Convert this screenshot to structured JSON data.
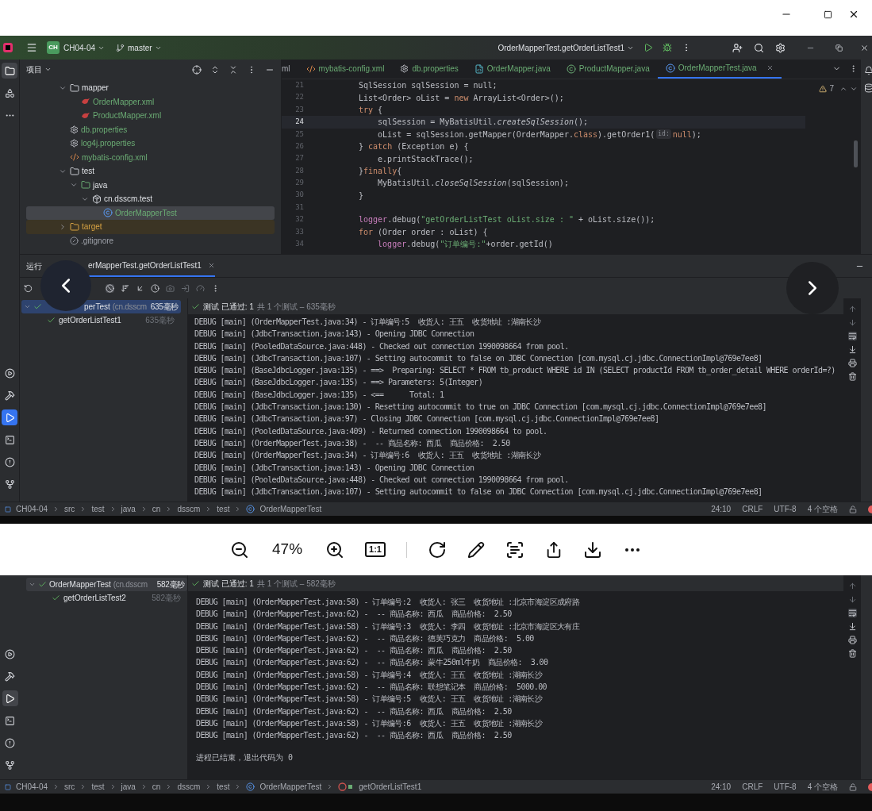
{
  "ide_top": {
    "project_badge": "CH",
    "project": "CH04-04",
    "branch": "master",
    "run_config": "OrderMapperTest.getOrderListTest1",
    "left_tools_top": [
      {
        "kind": "folder",
        "active": true
      },
      {
        "kind": "structure",
        "active": false
      },
      {
        "kind": "more",
        "active": false
      }
    ],
    "left_tools_bottom": [
      {
        "kind": "services",
        "active": false
      },
      {
        "kind": "build",
        "active": false
      },
      {
        "kind": "run",
        "active": true
      },
      {
        "kind": "terminal",
        "active": false
      },
      {
        "kind": "problems",
        "active": false
      },
      {
        "kind": "git",
        "active": false
      }
    ],
    "project_panel": {
      "title": "项目",
      "tree": [
        {
          "label": "mapper",
          "kind": "folder",
          "added": false,
          "expanded": true,
          "selected": false,
          "children": [
            {
              "label": "OrderMapper.xml",
              "kind": "mybatis",
              "added": true,
              "selected": false
            },
            {
              "label": "ProductMapper.xml",
              "kind": "mybatis",
              "added": true,
              "selected": false
            }
          ]
        },
        {
          "label": "db.properties",
          "kind": "settings",
          "added": true,
          "selected": false
        },
        {
          "label": "log4j.properties",
          "kind": "settings",
          "added": true,
          "selected": false
        },
        {
          "label": "mybatis-config.xml",
          "kind": "xml",
          "added": true,
          "selected": false
        },
        {
          "label": "test",
          "kind": "folder",
          "added": false,
          "expanded": true,
          "selected": false,
          "children": [
            {
              "label": "java",
              "kind": "source",
              "added": false,
              "expanded": true,
              "selected": false,
              "children": [
                {
                  "label": "cn.dsscm.test",
                  "kind": "package",
                  "added": false,
                  "expanded": true,
                  "selected": false,
                  "children": [
                    {
                      "label": "OrderMapperTest",
                      "kind": "class",
                      "added": true,
                      "selected": true
                    }
                  ]
                }
              ]
            }
          ]
        },
        {
          "label": "target",
          "kind": "excluded",
          "added": false,
          "expanded": false,
          "selected": false
        },
        {
          "label": ".gitignore",
          "kind": "ignore",
          "added": false,
          "selected": false
        }
      ]
    },
    "editor_tabs": [
      {
        "label": "ml",
        "kind": "none",
        "selected": false
      },
      {
        "label": "mybatis-config.xml",
        "kind": "xml",
        "selected": false
      },
      {
        "label": "db.properties",
        "kind": "settings",
        "selected": false
      },
      {
        "label": "OrderMapper.java",
        "kind": "mapper",
        "selected": false
      },
      {
        "label": "ProductMapper.java",
        "kind": "interface",
        "selected": false
      },
      {
        "label": "OrderMapperTest.java",
        "kind": "class",
        "selected": true
      }
    ],
    "warnings": "7",
    "code": [
      {
        "num": "21",
        "current": false,
        "segments": [
          {
            "t": "SqlSession sqlSession = null;",
            "kind": "plain"
          }
        ]
      },
      {
        "num": "22",
        "current": false,
        "segments": [
          {
            "t": "List<Order> oList = ",
            "kind": "plain"
          },
          {
            "t": "new",
            "kind": "kw"
          },
          {
            "t": " ArrayList<Order>();",
            "kind": "plain"
          }
        ]
      },
      {
        "num": "23",
        "current": false,
        "segments": [
          {
            "t": "try",
            "kind": "kw"
          },
          {
            "t": " {",
            "kind": "plain"
          }
        ]
      },
      {
        "num": "24",
        "current": true,
        "segments": [
          {
            "t": "    sqlSession",
            "kind": "plain"
          },
          {
            "t": " = MyBatisUtil.",
            "kind": "plain"
          },
          {
            "t": "createSqlSession",
            "kind": "static"
          },
          {
            "t": "();",
            "kind": "plain"
          }
        ]
      },
      {
        "num": "25",
        "current": false,
        "segments": [
          {
            "t": "    oList = sqlSession.getMapper(OrderMapper.",
            "kind": "plain"
          },
          {
            "t": "class",
            "kind": "kw"
          },
          {
            "t": ").getOrder1(",
            "kind": "plain"
          },
          {
            "t": "id:",
            "kind": "hint"
          },
          {
            "t": "null",
            "kind": "kw"
          },
          {
            "t": ");",
            "kind": "plain"
          }
        ]
      },
      {
        "num": "26",
        "current": false,
        "segments": [
          {
            "t": "} ",
            "kind": "plain"
          },
          {
            "t": "catch",
            "kind": "kw"
          },
          {
            "t": " (Exception e) {",
            "kind": "plain"
          }
        ]
      },
      {
        "num": "27",
        "current": false,
        "segments": [
          {
            "t": "    e.printStackTrace();",
            "kind": "plain"
          }
        ]
      },
      {
        "num": "28",
        "current": false,
        "segments": [
          {
            "t": "}",
            "kind": "plain"
          },
          {
            "t": "finally",
            "kind": "kw"
          },
          {
            "t": "{",
            "kind": "plain"
          }
        ]
      },
      {
        "num": "29",
        "current": false,
        "segments": [
          {
            "t": "    MyBatisUtil.",
            "kind": "plain"
          },
          {
            "t": "closeSqlSession",
            "kind": "static"
          },
          {
            "t": "(sqlSession);",
            "kind": "plain"
          }
        ]
      },
      {
        "num": "30",
        "current": false,
        "segments": [
          {
            "t": "}",
            "kind": "plain"
          }
        ]
      },
      {
        "num": "31",
        "current": false
      },
      {
        "num": "32",
        "current": false,
        "segments": [
          {
            "t": "logger",
            "kind": "field"
          },
          {
            "t": ".debug(",
            "kind": "plain"
          },
          {
            "t": "\"getOrderListTest oList.size : \"",
            "kind": "str"
          },
          {
            "t": " + oList.size());",
            "kind": "plain"
          }
        ]
      },
      {
        "num": "33",
        "current": false,
        "segments": [
          {
            "t": "for",
            "kind": "kw"
          },
          {
            "t": " (Order order : oList) {",
            "kind": "plain"
          }
        ]
      },
      {
        "num": "34",
        "current": false,
        "segments": [
          {
            "t": "    logger",
            "kind": "field"
          },
          {
            "t": ".debug(",
            "kind": "plain"
          },
          {
            "t": "\"订单编号:\"",
            "kind": "str"
          },
          {
            "t": "+order.getId()",
            "kind": "plain"
          }
        ]
      }
    ],
    "run_panel": {
      "title": "运行",
      "tab": "erMapperTest.getOrderListTest1",
      "tree": [
        {
          "label": "perTest",
          "package": "(cn.dsscm",
          "time": "635毫秒",
          "passed": true,
          "expanded": true,
          "selected": true,
          "children": [
            {
              "label": "getOrderListTest1",
              "time": "635毫秒",
              "passed": true,
              "selected": false
            }
          ]
        }
      ],
      "result": {
        "passed": true,
        "text": "测试 已通过: 1",
        "summary": "共 1 个测试 – 635毫秒"
      },
      "console": [
        "DEBUG [main] (OrderMapperTest.java:34) - 订单编号:5  收货人: 王五  收货地址 :湖南长沙",
        "DEBUG [main] (JdbcTransaction.java:143) - Opening JDBC Connection",
        "DEBUG [main] (PooledDataSource.java:448) - Checked out connection 1990098664 from pool.",
        "DEBUG [main] (JdbcTransaction.java:107) - Setting autocommit to false on JDBC Connection [com.mysql.cj.jdbc.ConnectionImpl@769e7ee8]",
        "DEBUG [main] (BaseJdbcLogger.java:135) - ==>  Preparing: SELECT * FROM tb_product WHERE id IN (SELECT productId FROM tb_order_detail WHERE orderId=?)",
        "DEBUG [main] (BaseJdbcLogger.java:135) - ==> Parameters: 5(Integer)",
        "DEBUG [main] (BaseJdbcLogger.java:135) - <==      Total: 1",
        "DEBUG [main] (JdbcTransaction.java:130) - Resetting autocommit to true on JDBC Connection [com.mysql.cj.jdbc.ConnectionImpl@769e7ee8]",
        "DEBUG [main] (JdbcTransaction.java:97) - Closing JDBC Connection [com.mysql.cj.jdbc.ConnectionImpl@769e7ee8]",
        "DEBUG [main] (PooledDataSource.java:409) - Returned connection 1990098664 to pool.",
        "DEBUG [main] (OrderMapperTest.java:38) -  -- 商品名称: 西瓜  商品价格:  2.50",
        "DEBUG [main] (OrderMapperTest.java:34) - 订单编号:6  收货人: 王五  收货地址 :湖南长沙",
        "DEBUG [main] (JdbcTransaction.java:143) - Opening JDBC Connection",
        "DEBUG [main] (PooledDataSource.java:448) - Checked out connection 1990098664 from pool.",
        "DEBUG [main] (JdbcTransaction.java:107) - Setting autocommit to false on JDBC Connection [com.mysql.cj.jdbc.ConnectionImpl@769e7ee8]"
      ]
    },
    "breadcrumbs": [
      "CH04-04",
      "src",
      "test",
      "java",
      "cn",
      "dsscm",
      "test",
      "OrderMapperTest"
    ],
    "status": [
      "24:10",
      "CRLF",
      "UTF-8",
      "4 个空格"
    ]
  },
  "viewer_toolbar": {
    "zoom": "47%",
    "actual_size": "1:1"
  },
  "ide_bottom": {
    "left_tools": [
      {
        "kind": "services",
        "active": false
      },
      {
        "kind": "build",
        "active": false
      },
      {
        "kind": "run",
        "active": true
      },
      {
        "kind": "terminal",
        "active": false
      },
      {
        "kind": "problems",
        "active": false
      },
      {
        "kind": "git",
        "active": false
      }
    ],
    "tree": [
      {
        "label": "OrderMapperTest",
        "package": "(cn.dsscm",
        "time": "582毫秒",
        "passed": true,
        "expanded": true,
        "selected": true,
        "children": [
          {
            "label": "getOrderListTest2",
            "time": "582毫秒",
            "passed": true,
            "selected": false
          }
        ]
      }
    ],
    "result": {
      "passed": true,
      "text": "测试 已通过: 1",
      "summary": "共 1 个测试 – 582毫秒"
    },
    "console": [
      "DEBUG [main] (OrderMapperTest.java:58) - 订单编号:2  收货人: 张三  收货地址 :北京市海淀区成府路",
      "DEBUG [main] (OrderMapperTest.java:62) -  -- 商品名称: 西瓜  商品价格:  2.50",
      "DEBUG [main] (OrderMapperTest.java:58) - 订单编号:3  收货人: 李四  收货地址 :北京市海淀区大有庄",
      "DEBUG [main] (OrderMapperTest.java:62) -  -- 商品名称: 德芙巧克力  商品价格:  5.00",
      "DEBUG [main] (OrderMapperTest.java:62) -  -- 商品名称: 西瓜  商品价格:  2.50",
      "DEBUG [main] (OrderMapperTest.java:62) -  -- 商品名称: 蒙牛250ml牛奶  商品价格:  3.00",
      "DEBUG [main] (OrderMapperTest.java:58) - 订单编号:4  收货人: 王五  收货地址 :湖南长沙",
      "DEBUG [main] (OrderMapperTest.java:62) -  -- 商品名称: 联想笔记本  商品价格:  5000.00",
      "DEBUG [main] (OrderMapperTest.java:58) - 订单编号:5  收货人: 王五  收货地址 :湖南长沙",
      "DEBUG [main] (OrderMapperTest.java:62) -  -- 商品名称: 西瓜  商品价格:  2.50",
      "DEBUG [main] (OrderMapperTest.java:58) - 订单编号:6  收货人: 王五  收货地址 :湖南长沙",
      "DEBUG [main] (OrderMapperTest.java:62) -  -- 商品名称: 西瓜  商品价格:  2.50"
    ],
    "exit_message": "进程已结束，退出代码为 0",
    "breadcrumbs": [
      "CH04-04",
      "src",
      "test",
      "java",
      "cn",
      "dsscm",
      "test",
      "OrderMapperTest",
      "getOrderListTest1"
    ],
    "status": [
      "24:10",
      "CRLF",
      "UTF-8",
      "4 个空格"
    ]
  }
}
